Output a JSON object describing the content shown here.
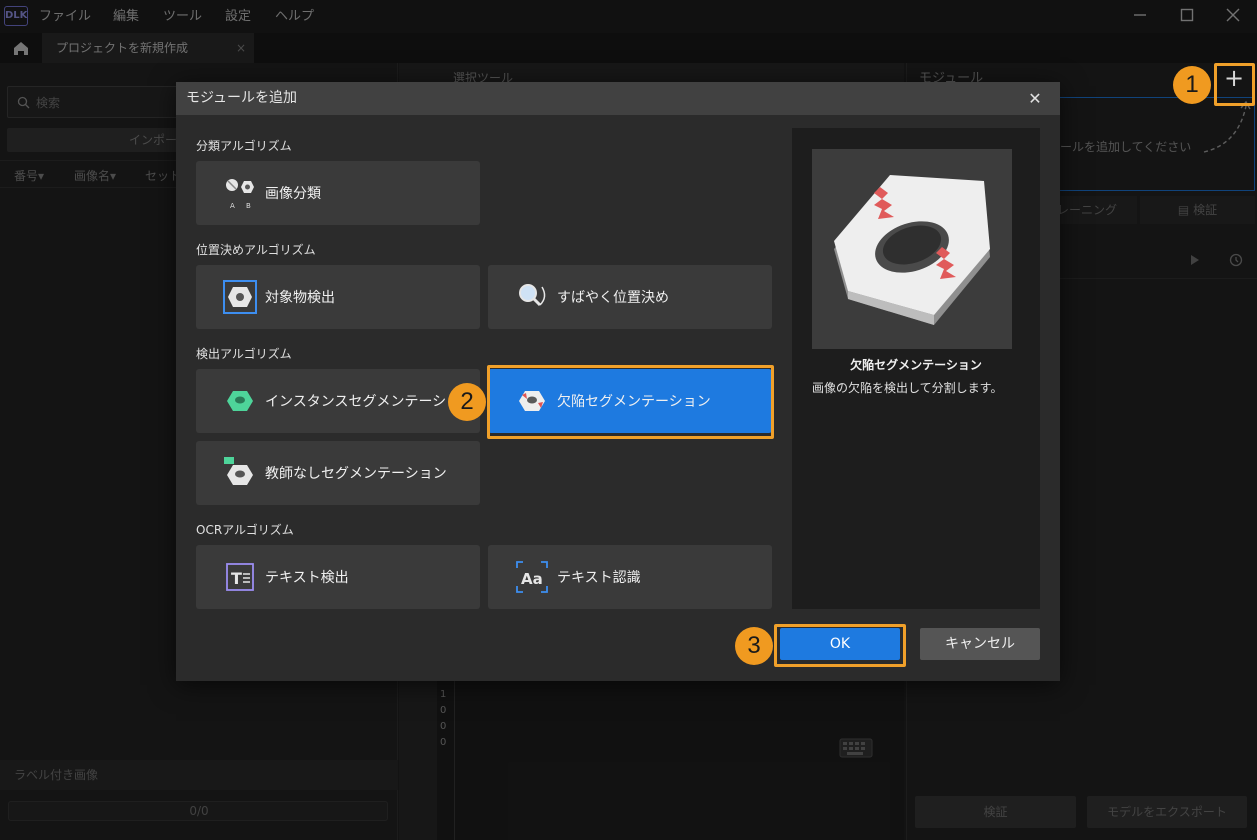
{
  "app": {
    "logo_text": "DLK",
    "menus": [
      "ファイル",
      "編集",
      "ツール",
      "設定",
      "ヘルプ"
    ],
    "window_controls": [
      "minimize-icon",
      "maximize-icon",
      "close-icon"
    ]
  },
  "tabs": {
    "home_icon": "home-icon",
    "project_tab": "プロジェクトを新規作成",
    "close": "×"
  },
  "left_panel": {
    "search_placeholder": "検索",
    "import_label": "インポー",
    "columns": [
      "番号▾",
      "画像名▾",
      "セット"
    ],
    "labeled_images": "ラベル付き画像",
    "progress_text": "0/0",
    "progress_fraction": 0
  },
  "center": {
    "header": "選択ツール",
    "ruler": [
      "1",
      "0",
      "0",
      "0"
    ]
  },
  "right_panel": {
    "header": "モジュール",
    "add_button": "+",
    "empty_hint": "ュールを追加してください",
    "subtabs": [
      "レーニング",
      "検証"
    ],
    "verify_button": "検証",
    "export_button": "モデルをエクスポート"
  },
  "dialog": {
    "title": "モジュールを追加",
    "close": "✕",
    "sections": {
      "classification": "分類アルゴリズム",
      "positioning": "位置決めアルゴリズム",
      "detection": "検出アルゴリズム",
      "ocr": "OCRアルゴリズム"
    },
    "modules": {
      "image_classification": "画像分類",
      "object_detection": "対象物検出",
      "fast_positioning": "すばやく位置決め",
      "instance_segmentation": "インスタンスセグメンテーション",
      "defect_segmentation": "欠陥セグメンテーション",
      "unsupervised_segmentation": "教師なしセグメンテーション",
      "text_detection": "テキスト検出",
      "text_recognition": "テキスト認識"
    },
    "preview": {
      "name": "欠陥セグメンテーション",
      "description": "画像の欠陥を検出して分割します。"
    },
    "ok": "OK",
    "cancel": "キャンセル"
  },
  "steps": [
    "1",
    "2",
    "3"
  ],
  "colors": {
    "accent": "#1e7ae0",
    "highlight": "#f0a02a",
    "background": "#232323"
  }
}
